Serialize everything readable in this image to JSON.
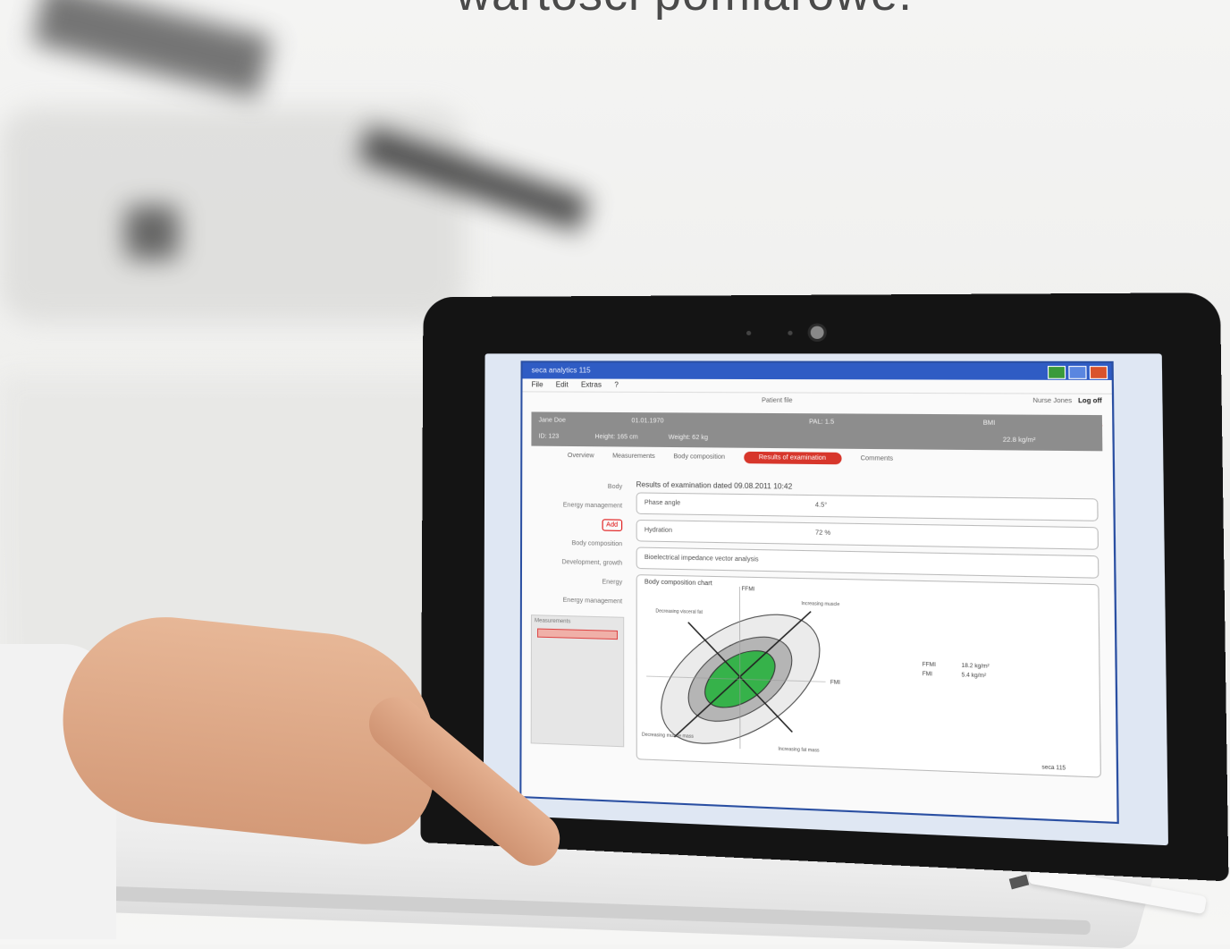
{
  "headline": "wartości pomiarowe.",
  "app": {
    "window_title": "seca analytics 115",
    "menu": [
      "File",
      "Edit",
      "Extras",
      "?"
    ],
    "user_label": "Nurse Jones",
    "logoff": "Log off",
    "brand": "seca",
    "page_header": "Patient file",
    "patient": {
      "name": "Jane Doe",
      "dob": "01.01.1970",
      "id": "ID: 123",
      "height": "Height: 165 cm",
      "weight": "Weight: 62 kg",
      "pal": "PAL: 1.5",
      "bmi_label": "BMI",
      "bmi_value": "22.8 kg/m²"
    },
    "tabs": [
      "Overview",
      "Measurements",
      "Body composition",
      "Results of examination",
      "Comments"
    ],
    "active_tab_index": 3,
    "sidebar": [
      "Body",
      "Energy management",
      "Body composition",
      "Development, growth",
      "Energy",
      "Energy management"
    ],
    "sidebar_button": "Add",
    "sidebar_box_label": "Measurements",
    "results_title": "Results of examination dated 09.08.2011 10:42",
    "panels": [
      {
        "label": "Phase angle",
        "value": "4.5°"
      },
      {
        "label": "Hydration",
        "value": "72 %"
      },
      {
        "label": "Bioelectrical impedance vector analysis",
        "value": ""
      }
    ],
    "chart_header": "Body composition chart",
    "chart_labels": {
      "fmi": "FMI",
      "ffmi": "FFMI",
      "decreasing_fat": "Decreasing visceral fat",
      "increasing_muscle": "Increasing muscle",
      "increasing_fat": "Increasing fat mass",
      "decreasing_muscle": "Decreasing muscle mass"
    },
    "chart_legend": [
      {
        "label": "FFMI",
        "value": "18.2 kg/m²"
      },
      {
        "label": "FMI",
        "value": "5.4 kg/m²"
      }
    ],
    "footer_tag": "seca 115"
  },
  "colors": {
    "accent_red": "#e23b2e",
    "titlebar_blue": "#2f5cc4",
    "chart_green": "#36b24a"
  }
}
